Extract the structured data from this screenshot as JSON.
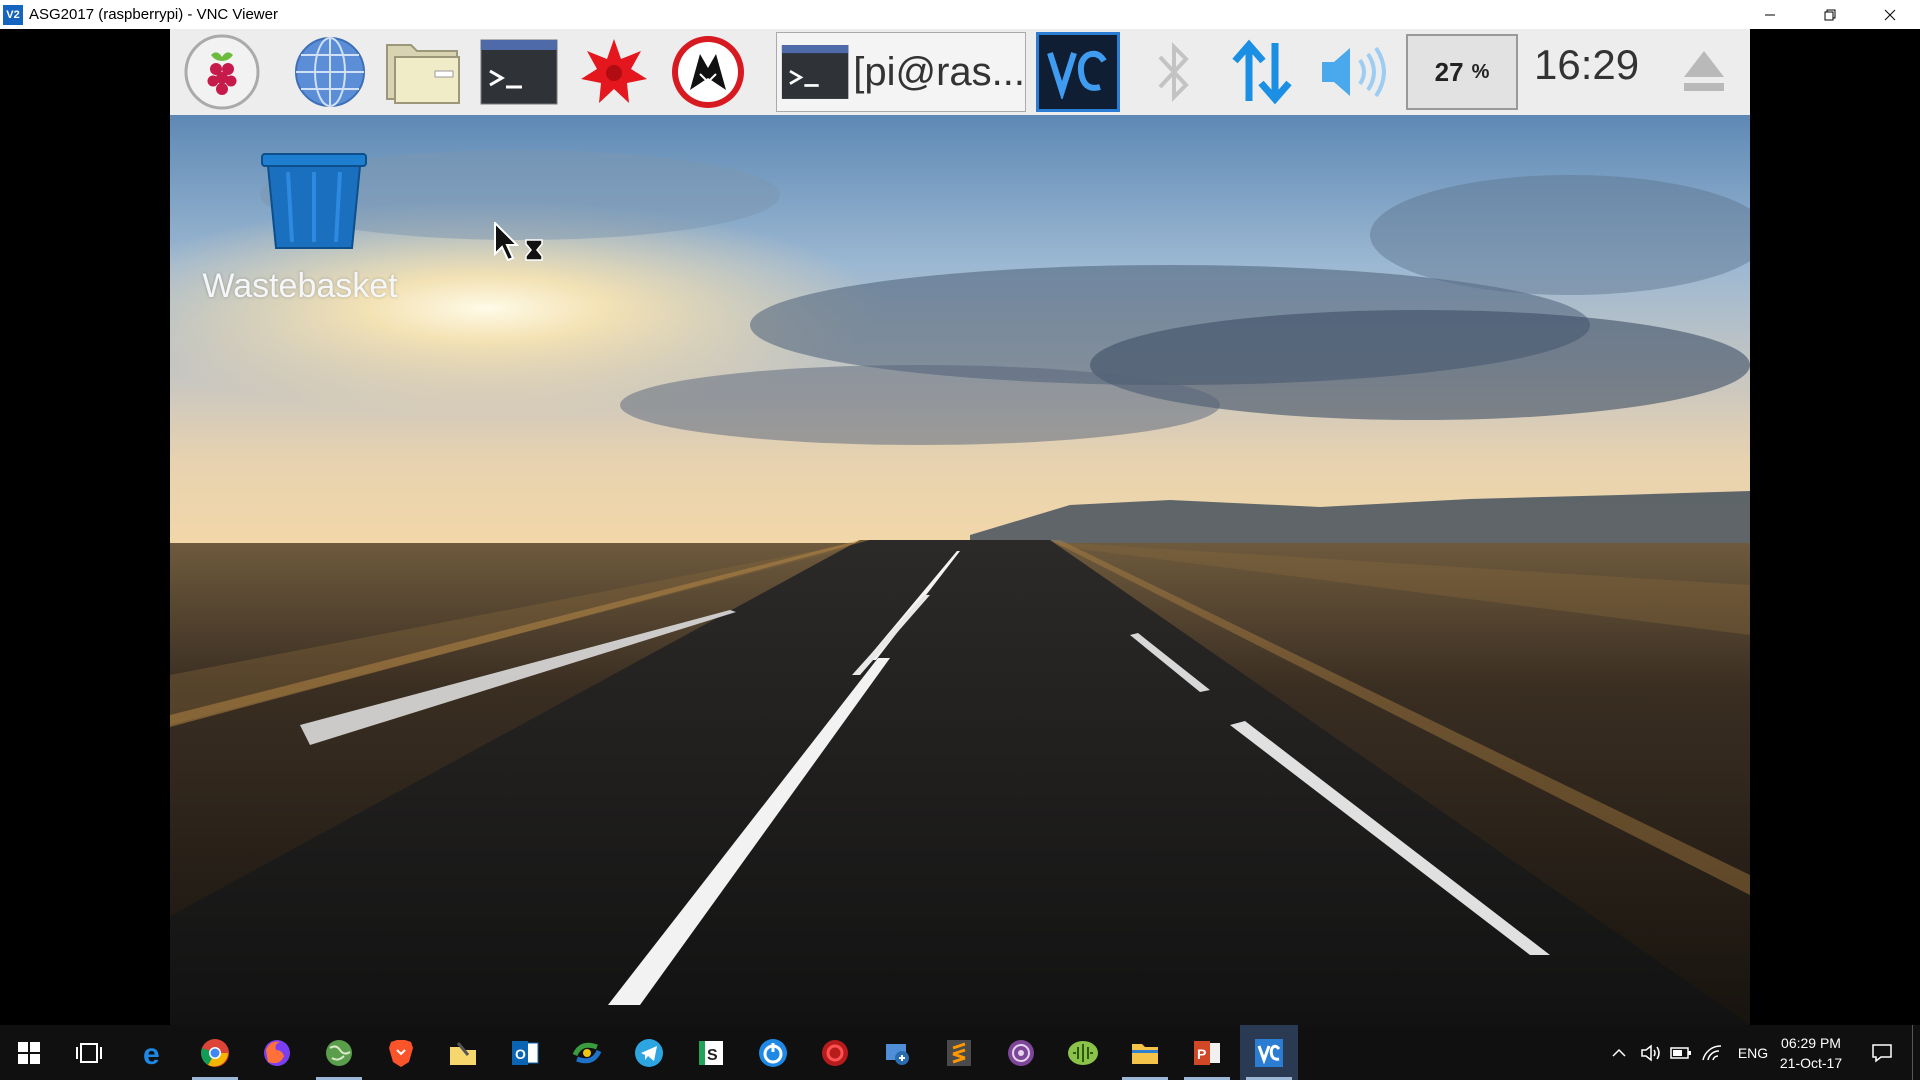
{
  "window": {
    "title": "ASG2017 (raspberrypi) - VNC Viewer",
    "app_icon_text": "V2",
    "controls": [
      "minimize",
      "restore",
      "close"
    ]
  },
  "pi_panel": {
    "launchers": [
      "raspberry-menu",
      "web-browser",
      "file-manager",
      "terminal",
      "mathematica",
      "wolfram"
    ],
    "task_button_label": "[pi@ras...",
    "tray_icons": [
      "vnc",
      "bluetooth",
      "network",
      "volume"
    ],
    "cpu_percent": "27",
    "cpu_unit": "%",
    "clock": "16:29"
  },
  "desktop": {
    "trash_label": "Wastebasket"
  },
  "taskbar": {
    "pinned": [
      "edge",
      "chrome",
      "firefox",
      "earth",
      "brave",
      "file-editor",
      "outlook",
      "sync",
      "telegram",
      "slack-s",
      "power",
      "red-app",
      "remote-desktop",
      "sublime",
      "tor",
      "green-app",
      "file-explorer",
      "powerpoint",
      "vnc-viewer"
    ],
    "language": "ENG",
    "time": "06:29 PM",
    "date": "21-Oct-17"
  },
  "colors": {
    "panel_bg": "#ededed",
    "taskbar_bg": "#101010",
    "vnc_accent": "#2b7cd3"
  }
}
